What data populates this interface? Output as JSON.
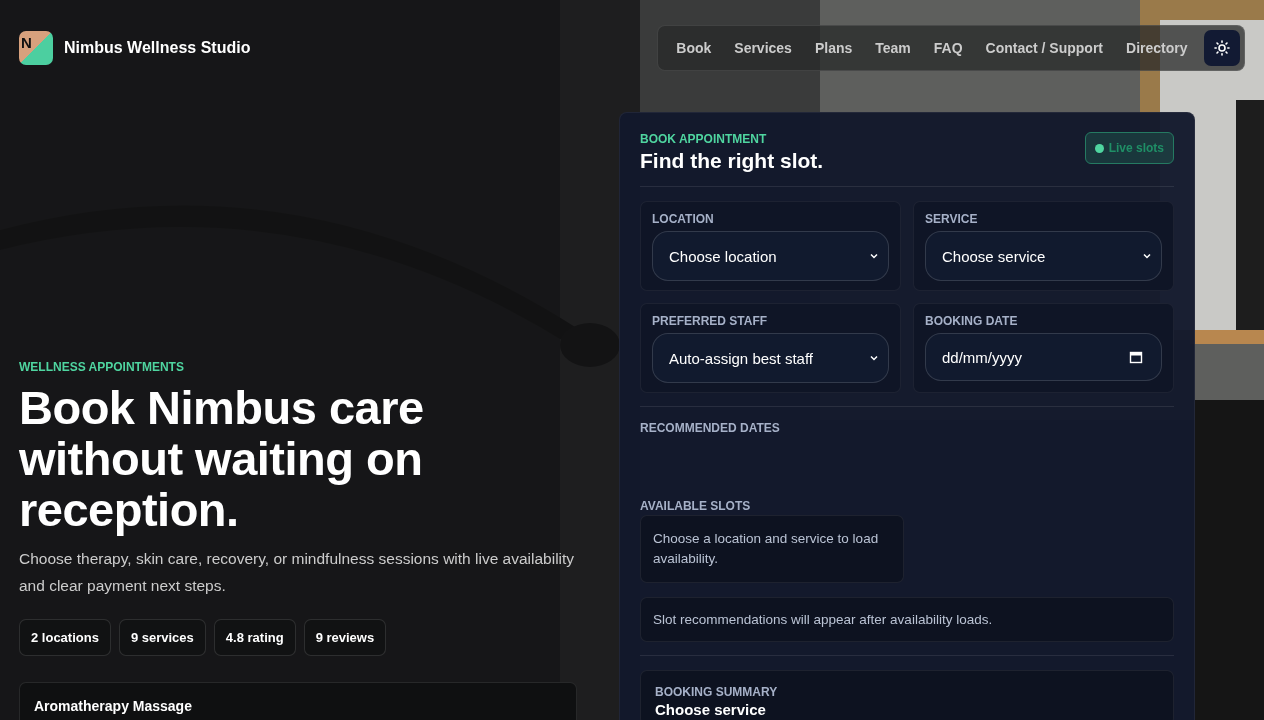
{
  "brand": {
    "logo_letter": "N",
    "name": "Nimbus Wellness Studio"
  },
  "nav": {
    "links": [
      {
        "label": "Book"
      },
      {
        "label": "Services"
      },
      {
        "label": "Plans"
      },
      {
        "label": "Team"
      },
      {
        "label": "FAQ"
      },
      {
        "label": "Contact / Support"
      },
      {
        "label": "Directory"
      }
    ]
  },
  "hero": {
    "eyebrow": "WELLNESS APPOINTMENTS",
    "title": "Book Nimbus care without waiting on reception.",
    "description": "Choose therapy, skin care, recovery, or mindfulness sessions with live availability and clear payment next steps.",
    "stats": [
      "2 locations",
      "9 services",
      "4.8 rating",
      "9 reviews"
    ],
    "service_card": {
      "title": "Aromatherapy Massage"
    }
  },
  "booking": {
    "eyebrow": "BOOK APPOINTMENT",
    "title": "Find the right slot.",
    "live_badge": {
      "label": "Live slots",
      "on": true
    },
    "fields": [
      {
        "label": "LOCATION",
        "kind": "select",
        "value": "Choose location"
      },
      {
        "label": "SERVICE",
        "kind": "select",
        "value": "Choose service"
      },
      {
        "label": "PREFERRED STAFF",
        "kind": "select",
        "value": "Auto-assign best staff"
      },
      {
        "label": "BOOKING DATE",
        "kind": "date",
        "placeholder": "dd/mm/yyyy"
      }
    ],
    "recommended_dates": {
      "label": "RECOMMENDED DATES"
    },
    "available_slots": {
      "label": "AVAILABLE SLOTS",
      "message": "Choose a location and service to load availability."
    },
    "recommendation_note": "Slot recommendations will appear after availability loads.",
    "summary": {
      "label": "BOOKING SUMMARY",
      "title": "Choose service"
    }
  }
}
